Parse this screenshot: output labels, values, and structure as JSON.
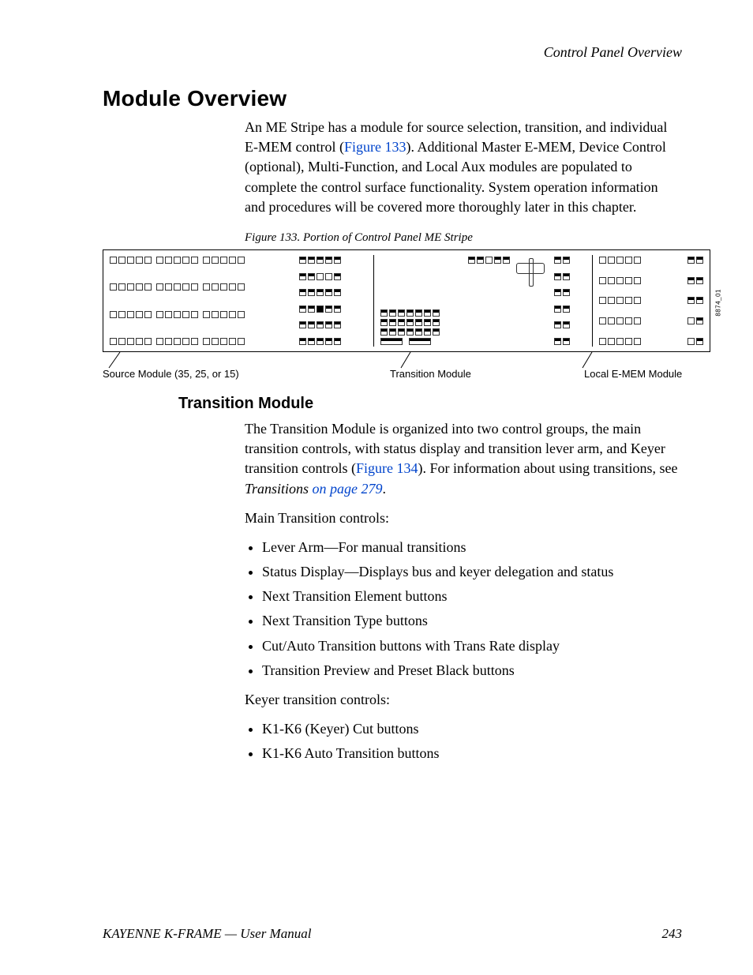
{
  "running_header": "Control Panel Overview",
  "h1": "Module Overview",
  "intro": {
    "part1": "An ME Stripe has a module for source selection, transition, and individual E-MEM control (",
    "figref": "Figure 133",
    "part2": "). Additional Master E-MEM, Device Control (optional), Multi-Function, and Local Aux modules are populated to complete the control surface functionality. System operation information and procedures will be covered more thoroughly later in this chapter."
  },
  "figure_caption": "Figure 133.  Portion of Control Panel ME Stripe",
  "figure_side_label": "8874_01",
  "callouts": {
    "source_module": "Source Module (35, 25, or 15)",
    "transition_module": "Transition Module",
    "local_emem_module": "Local E-MEM Module"
  },
  "h2": "Transition Module",
  "tm_para": {
    "part1": "The Transition Module is organized into two control groups, the main transition controls, with status display and transition lever arm, and Keyer transition controls (",
    "figref": "Figure 134",
    "part2": "). For information about using transitions, see ",
    "link_prefix_italic": "Transitions ",
    "link_text": "on page 279",
    "tail": "."
  },
  "main_controls_label": "Main Transition controls:",
  "main_controls": [
    "Lever Arm—For manual transitions",
    "Status Display—Displays bus and keyer delegation and status",
    "Next Transition Element buttons",
    "Next Transition Type buttons",
    "Cut/Auto Transition buttons with Trans Rate display",
    "Transition Preview and Preset Black buttons"
  ],
  "keyer_controls_label": "Keyer transition controls:",
  "keyer_controls": [
    "K1-K6 (Keyer) Cut buttons",
    "K1-K6 Auto Transition buttons"
  ],
  "footer": {
    "doc_title": "KAYENNE K-FRAME — User Manual",
    "page_number": "243"
  }
}
